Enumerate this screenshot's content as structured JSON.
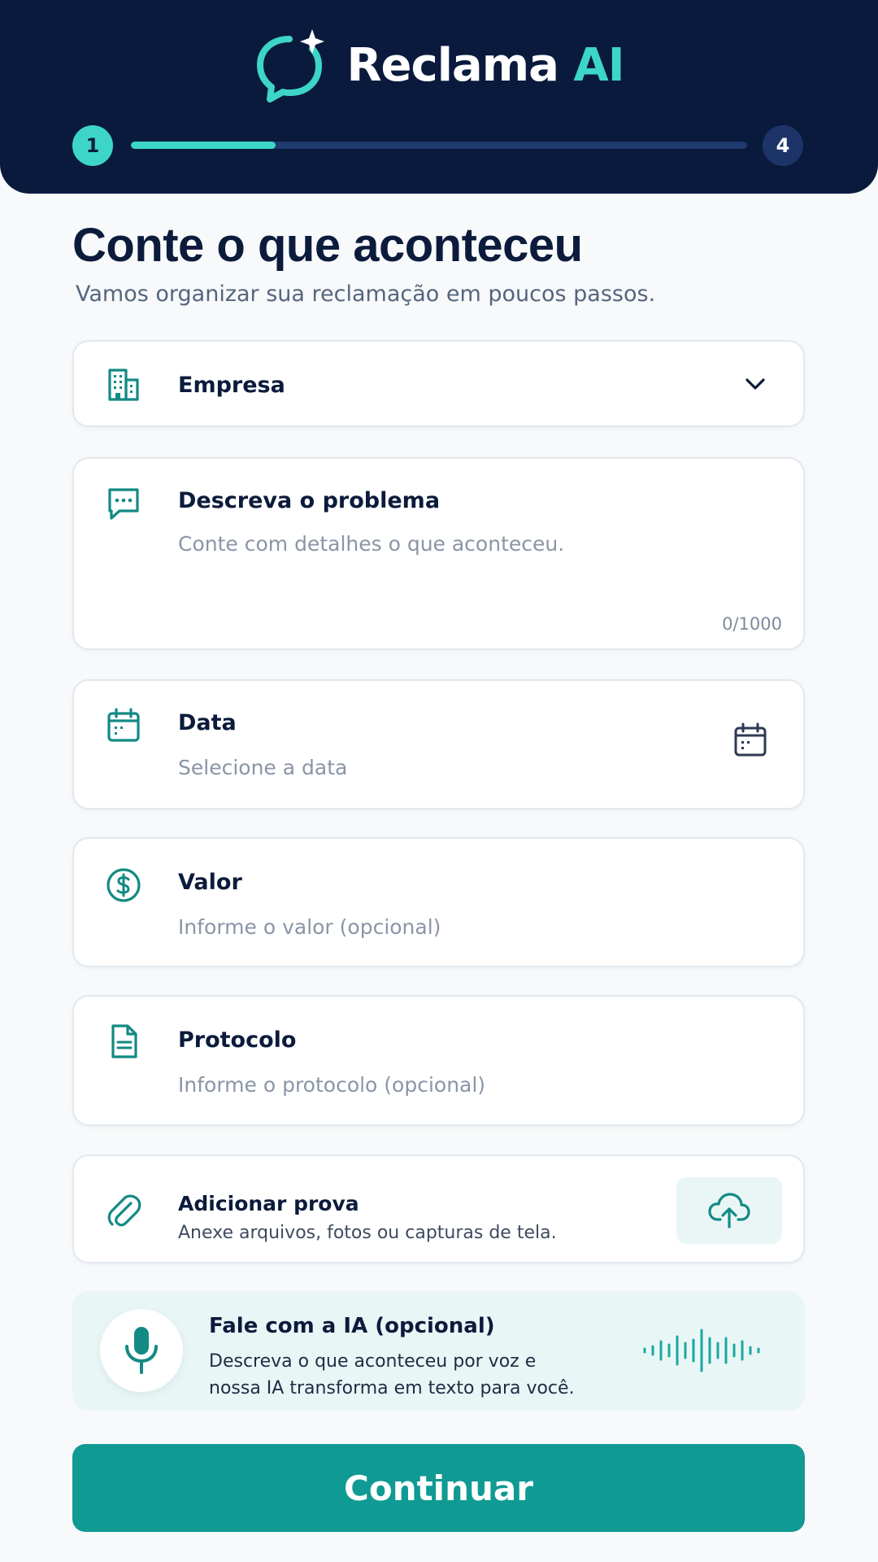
{
  "header": {
    "brand_name": "Reclama",
    "brand_ai": "AI",
    "step_current": "1",
    "step_total": "4",
    "progress_fraction": 0.235
  },
  "page": {
    "title": "Conte o que aconteceu",
    "subtitle": "Vamos organizar sua reclamação em poucos passos."
  },
  "form": {
    "company": {
      "label": "Empresa",
      "icon": "building-icon"
    },
    "problem": {
      "label": "Descreva o problema",
      "placeholder": "Conte com detalhes o que aconteceu.",
      "counter": "0/1000",
      "icon": "chat-icon"
    },
    "date": {
      "label": "Data",
      "placeholder": "Selecione a data",
      "icon": "calendar-icon"
    },
    "value": {
      "label": "Valor",
      "placeholder": "Informe o valor (opcional)",
      "icon": "dollar-icon"
    },
    "protocol": {
      "label": "Protocolo",
      "placeholder": "Informe o protocolo (opcional)",
      "icon": "document-icon"
    },
    "proof": {
      "label": "Adicionar prova",
      "description": "Anexe arquivos, fotos ou capturas de tela.",
      "icon": "paperclip-icon"
    }
  },
  "voice": {
    "title": "Fale com a IA (opcional)",
    "description": "Descreva o que aconteceu por voz e nossa IA transforma em texto para você.",
    "icon": "microphone-icon"
  },
  "actions": {
    "continue_label": "Continuar"
  },
  "colors": {
    "header_bg": "#0a1a3d",
    "accent": "#3dd6c6",
    "primary_button": "#0f9a93",
    "icon_teal": "#138a84"
  }
}
